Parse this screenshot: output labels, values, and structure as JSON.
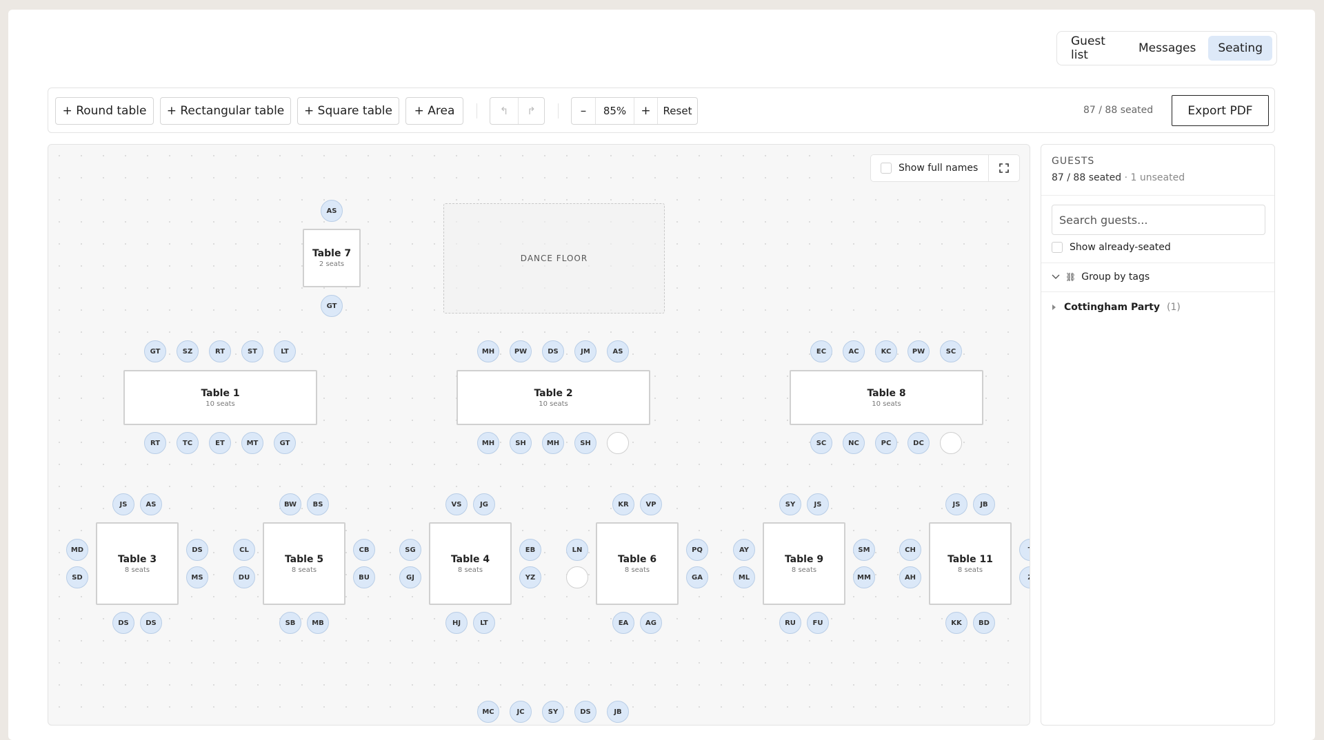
{
  "nav": {
    "tabs": [
      {
        "label": "Guest list",
        "active": false
      },
      {
        "label": "Messages",
        "active": false
      },
      {
        "label": "Seating",
        "active": true
      }
    ]
  },
  "toolbar": {
    "add_round": "+ Round table",
    "add_rect": "+ Rectangular table",
    "add_square": "+ Square table",
    "add_area": "+ Area",
    "undo_icon": "↰",
    "redo_icon": "↱",
    "zoom_out": "–",
    "zoom": "85%",
    "zoom_in": "+",
    "reset": "Reset",
    "seated": "87 / 88 seated",
    "export": "Export PDF"
  },
  "canvas": {
    "show_full_names": "Show full names",
    "dance_floor": "DANCE FLOOR",
    "tables": [
      {
        "name": "Table 7",
        "seats": "2 seats",
        "top": [
          "AS"
        ],
        "bottom": [
          "GT"
        ]
      },
      {
        "name": "Table 1",
        "seats": "10 seats",
        "top": [
          "GT",
          "SZ",
          "RT",
          "ST",
          "LT"
        ],
        "bottom": [
          "RT",
          "TC",
          "ET",
          "MT",
          "GT"
        ]
      },
      {
        "name": "Table 2",
        "seats": "10 seats",
        "top": [
          "MH",
          "PW",
          "DS",
          "JM",
          "AS"
        ],
        "bottom": [
          "MH",
          "SH",
          "MH",
          "SH",
          ""
        ]
      },
      {
        "name": "Table 8",
        "seats": "10 seats",
        "top": [
          "EC",
          "AC",
          "KC",
          "PW",
          "SC"
        ],
        "bottom": [
          "SC",
          "NC",
          "PC",
          "DC",
          ""
        ]
      },
      {
        "name": "Table 3",
        "seats": "8 seats",
        "top": [
          "JS",
          "AS"
        ],
        "bottom": [
          "DS",
          "DS"
        ],
        "left": [
          "MD",
          "SD"
        ],
        "right": [
          "DS",
          "MS"
        ]
      },
      {
        "name": "Table 5",
        "seats": "8 seats",
        "top": [
          "BW",
          "BS"
        ],
        "bottom": [
          "SB",
          "MB"
        ],
        "left": [
          "CL",
          "DU"
        ],
        "right": [
          "CB",
          "BU"
        ]
      },
      {
        "name": "Table 4",
        "seats": "8 seats",
        "top": [
          "VS",
          "JG"
        ],
        "bottom": [
          "HJ",
          "LT"
        ],
        "left": [
          "SG",
          "GJ"
        ],
        "right": [
          "EB",
          "YZ"
        ]
      },
      {
        "name": "Table 6",
        "seats": "8 seats",
        "top": [
          "KR",
          "VP"
        ],
        "bottom": [
          "EA",
          "AG"
        ],
        "left": [
          "LN",
          ""
        ],
        "right": [
          "PQ",
          "GA"
        ]
      },
      {
        "name": "Table 9",
        "seats": "8 seats",
        "top": [
          "SY",
          "JS"
        ],
        "bottom": [
          "RU",
          "FU"
        ],
        "left": [
          "AY",
          "ML"
        ],
        "right": [
          "SM",
          "MM"
        ]
      },
      {
        "name": "Table 11",
        "seats": "8 seats",
        "top": [
          "JS",
          "JB"
        ],
        "bottom": [
          "KK",
          "BD"
        ],
        "left": [
          "CH",
          "AH"
        ],
        "right": [
          "T",
          "Z"
        ]
      },
      {
        "name": "",
        "seats": "",
        "top": [
          "MC",
          "JC",
          "SY",
          "DS",
          "JB"
        ]
      }
    ]
  },
  "guests_panel": {
    "heading": "GUESTS",
    "count": "87 / 88 seated",
    "unseated": "· 1 unseated",
    "search_placeholder": "Search guests...",
    "show_seated": "Show already-seated",
    "group_by": "Group by tags",
    "group_icon": "⛓",
    "groups": [
      {
        "name": "Cottingham Party",
        "count": "(1)"
      }
    ]
  }
}
